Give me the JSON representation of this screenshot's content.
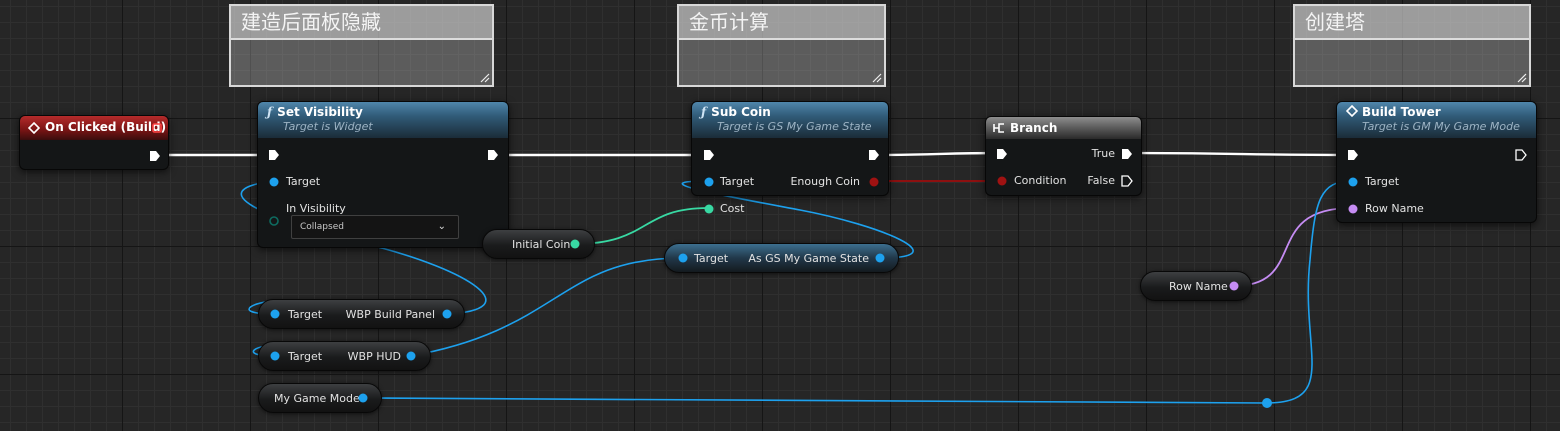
{
  "comments": [
    {
      "title": "建造后面板隐藏"
    },
    {
      "title": "金币计算"
    },
    {
      "title": "创建塔"
    }
  ],
  "event_node": {
    "title": "On Clicked (Build)"
  },
  "set_visibility": {
    "title": "Set Visibility",
    "subtitle": "Target is Widget",
    "target_label": "Target",
    "in_visibility_label": "In Visibility",
    "in_visibility_value": "Collapsed"
  },
  "sub_coin": {
    "title": "Sub Coin",
    "subtitle": "Target is GS My Game State",
    "target_label": "Target",
    "cost_label": "Cost",
    "enough_coin_label": "Enough Coin"
  },
  "branch": {
    "title": "Branch",
    "condition_label": "Condition",
    "true_label": "True",
    "false_label": "False"
  },
  "build_tower": {
    "title": "Build Tower",
    "subtitle": "Target is GM My Game Mode",
    "target_label": "Target",
    "row_name_label": "Row Name"
  },
  "variables": {
    "initial_coin": "Initial Coin",
    "row_name": "Row Name",
    "my_game_mode": "My Game Mode"
  },
  "cast_node": {
    "target_label": "Target",
    "output_label": "As GS My Game State"
  },
  "get_build_panel": {
    "target_label": "Target",
    "output_label": "WBP Build Panel"
  },
  "get_hud": {
    "target_label": "Target",
    "output_label": "WBP HUD"
  },
  "colors": {
    "exec": "#ffffff",
    "object": "#1da1ee",
    "float": "#38d9a3",
    "bool": "#9d1010",
    "name": "#c58cf3",
    "enum": "#0e6b60"
  }
}
